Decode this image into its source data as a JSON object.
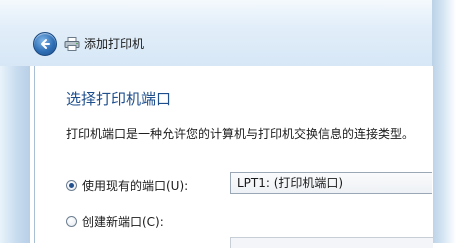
{
  "window": {
    "title": "添加打印机"
  },
  "page": {
    "heading": "选择打印机端口",
    "description": "打印机端口是一种允许您的计算机与打印机交换信息的连接类型。"
  },
  "options": {
    "use_existing": {
      "label": "使用现有的端口(U):",
      "checked": true
    },
    "create_new": {
      "label": "创建新端口(C):",
      "checked": false
    }
  },
  "existing_port_select": {
    "value": "LPT1: (打印机端口)"
  },
  "icons": {
    "back": "back-arrow-icon",
    "printer": "printer-icon"
  },
  "colors": {
    "heading": "#1e4e8c",
    "back_button": "#2f6fb6"
  }
}
